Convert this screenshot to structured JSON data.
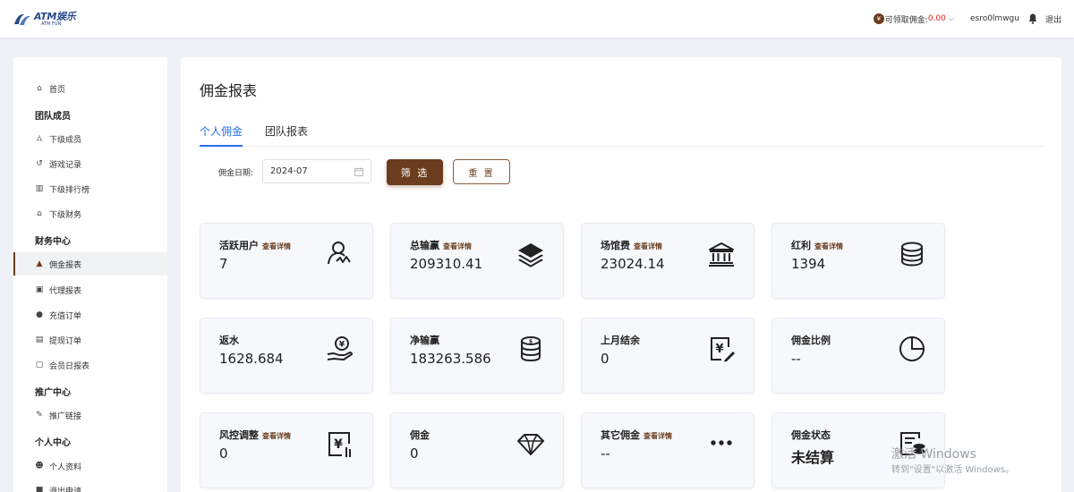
{
  "header": {
    "logo_text": "ATM娱乐",
    "logo_sub": "ATM FUN",
    "commission_label": "可领取佣金:",
    "commission_value": "0.00",
    "coin_symbol": "¥",
    "username": "esro0lmwgu",
    "logout": "退出"
  },
  "sidebar": {
    "home": "首页",
    "sections": [
      {
        "title": "团队成员",
        "items": [
          "下级成员",
          "游戏记录",
          "下级排行榜",
          "下级财务"
        ]
      },
      {
        "title": "财务中心",
        "items": [
          "佣金报表",
          "代理报表",
          "充值订单",
          "提现订单",
          "会员日报表"
        ]
      },
      {
        "title": "推广中心",
        "items": [
          "推广链接"
        ]
      },
      {
        "title": "个人中心",
        "items": [
          "个人资料",
          "退出申请"
        ]
      }
    ],
    "active_item": "佣金报表"
  },
  "main": {
    "title": "佣金报表",
    "tabs": [
      "个人佣金",
      "团队报表"
    ],
    "active_tab": "个人佣金",
    "filter": {
      "date_label": "佣金日期:",
      "date_value": "2024-07",
      "filter_button": "筛 选",
      "reset_button": "重 置"
    },
    "cards": [
      {
        "label": "活跃用户",
        "detail": "查看详情",
        "value": "7",
        "icon": "user-chart-icon"
      },
      {
        "label": "总输赢",
        "detail": "查看详情",
        "value": "209310.41",
        "icon": "layers-icon"
      },
      {
        "label": "场馆费",
        "detail": "查看详情",
        "value": "23024.14",
        "icon": "bank-icon"
      },
      {
        "label": "红利",
        "detail": "查看详情",
        "value": "1394",
        "icon": "database-icon"
      },
      {
        "label": "返水",
        "detail": "",
        "value": "1628.684",
        "icon": "hand-coin-icon"
      },
      {
        "label": "净输赢",
        "detail": "",
        "value": "183263.586",
        "icon": "coin-stack-icon"
      },
      {
        "label": "上月结余",
        "detail": "",
        "value": "0",
        "icon": "yen-edit-icon"
      },
      {
        "label": "佣金比例",
        "detail": "",
        "value": "--",
        "icon": "pie-icon"
      },
      {
        "label": "风控调整",
        "detail": "查看详情",
        "value": "0",
        "icon": "yen-adjust-icon"
      },
      {
        "label": "佣金",
        "detail": "",
        "value": "0",
        "icon": "diamond-icon"
      },
      {
        "label": "其它佣金",
        "detail": "查看详情",
        "value": "--",
        "icon": "more-icon"
      },
      {
        "label": "佣金状态",
        "detail": "",
        "value": "未结算",
        "icon": "wallet-coin-icon"
      }
    ]
  },
  "watermark": {
    "line1": "激活 Windows",
    "line2": "转到\"设置\"以激活 Windows。"
  },
  "colors": {
    "brand": "#6b3d1e",
    "accent_blue": "#2a6ff0",
    "amount_red": "#e02020"
  }
}
